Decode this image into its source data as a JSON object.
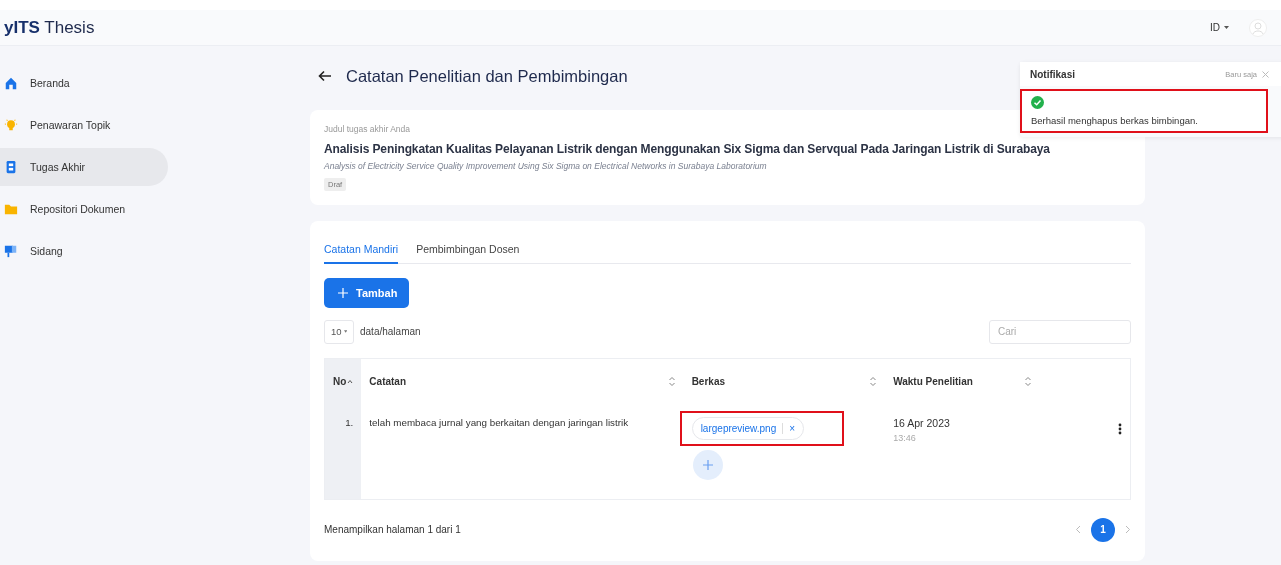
{
  "header": {
    "logo": "**yITS** Thesis",
    "language": "ID"
  },
  "sidebar": {
    "items": [
      {
        "label": "Beranda",
        "kind": "home",
        "selected": false
      },
      {
        "label": "Penawaran Topik",
        "kind": "bulb",
        "selected": false
      },
      {
        "label": "Tugas Akhir",
        "kind": "document",
        "selected": true
      },
      {
        "label": "Repositori Dokumen",
        "kind": "folder",
        "selected": false
      },
      {
        "label": "Sidang",
        "kind": "board",
        "selected": false
      }
    ]
  },
  "page": {
    "title": "Catatan Penelitian dan Pembimbingan"
  },
  "thesis_card": {
    "label": "Judul tugas akhir Anda",
    "title": "Analisis Peningkatan Kualitas Pelayanan Listrik dengan Menggunakan Six Sigma dan Servqual Pada Jaringan Listrik di Surabaya",
    "subtitle": "Analysis of Electricity Service Quality Improvement Using Six Sigma on Electrical Networks in Surabaya Laboratorium",
    "status": "Draf"
  },
  "tabs": [
    {
      "label": "Catatan Mandiri",
      "selected": true
    },
    {
      "label": "Pembimbingan Dosen",
      "selected": false
    }
  ],
  "add_button": "Tambah",
  "page_size": {
    "value": "10",
    "label": "data/halaman"
  },
  "search": {
    "placeholder": "Cari"
  },
  "table": {
    "columns": [
      {
        "label": "No",
        "sorted": true
      },
      {
        "label": "Catatan",
        "sorted": false
      },
      {
        "label": "Berkas",
        "sorted": false
      },
      {
        "label": "Waktu Penelitian",
        "sorted": false
      }
    ],
    "rows": [
      {
        "no": "1.",
        "note": "telah membaca jurnal yang berkaitan dengan jaringan listrik",
        "files": [
          {
            "name": "largepreview.png",
            "remove": "×"
          }
        ],
        "date": "16 Apr 2023",
        "time": "13:46"
      }
    ]
  },
  "footer": {
    "summary": "Menampilkan halaman 1 dari 1",
    "pages": [
      {
        "label": "1",
        "selected": true
      }
    ]
  },
  "notification": {
    "title": "Notifikasi",
    "time": "Baru saja",
    "message": "Berhasil menghapus berkas bimbingan."
  }
}
